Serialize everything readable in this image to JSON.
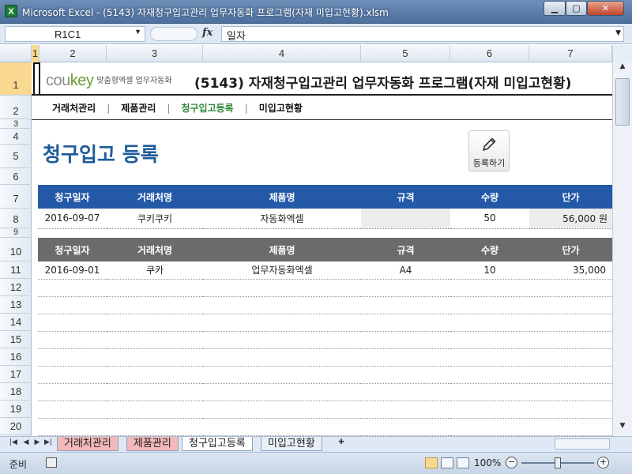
{
  "window": {
    "title": "Microsoft Excel - (5143) 자재청구입고관리 업무자동화 프로그램(자재 미입고현황).xlsm",
    "app_icon": "X",
    "min_glyph": "▁",
    "max_glyph": "▢",
    "close_glyph": "✕"
  },
  "formula_bar": {
    "name_box": "R1C1",
    "fx": "fx",
    "content": "일자"
  },
  "columns": [
    "1",
    "2",
    "3",
    "4",
    "5",
    "6",
    "7"
  ],
  "rows": [
    "1",
    "2",
    "3",
    "4",
    "5",
    "6",
    "7",
    "8",
    "9",
    "10",
    "11",
    "12",
    "13",
    "14",
    "15",
    "16",
    "17",
    "18",
    "19",
    "20"
  ],
  "header": {
    "logo_cou": "cou",
    "logo_key": "key",
    "logo_tagline": "맞춤형엑셀 업무자동화",
    "title": "(5143) 자재청구입고관리 업무자동화 프로그램(자재 미입고현황)"
  },
  "nav": {
    "items": [
      "거래처관리",
      "제품관리",
      "청구입고등록",
      "미입고현황"
    ],
    "separator": "|"
  },
  "page": {
    "title": "청구입고 등록",
    "register_button": "등록하기",
    "register_icon": "pencil-icon"
  },
  "input_table": {
    "headers": [
      "청구일자",
      "거래처명",
      "제품명",
      "규격",
      "수량",
      "단가"
    ],
    "row": [
      "2016-09-07",
      "쿠키쿠키",
      "자동화엑셀",
      "",
      "50",
      "56,000 원"
    ]
  },
  "list_table": {
    "headers": [
      "청구일자",
      "거래처명",
      "제품명",
      "규격",
      "수량",
      "단가"
    ],
    "rows": [
      [
        "2016-09-01",
        "쿠카",
        "업무자동화엑셀",
        "A4",
        "10",
        "35,000"
      ]
    ],
    "empty_rows": 9
  },
  "sheet_tabs": {
    "tabs": [
      "거래처관리",
      "제품관리",
      "청구입고등록",
      "미입고현황"
    ],
    "active": "청구입고등록"
  },
  "status": {
    "ready": "준비",
    "zoom": "100%",
    "zoom_minus": "−",
    "zoom_plus": "+"
  },
  "colors": {
    "input_header": "#2459a8",
    "list_header": "#6b6b6b",
    "page_title": "#1f5c99",
    "nav_active": "#2e8b3a",
    "tab_red": "#f3b8b8"
  }
}
